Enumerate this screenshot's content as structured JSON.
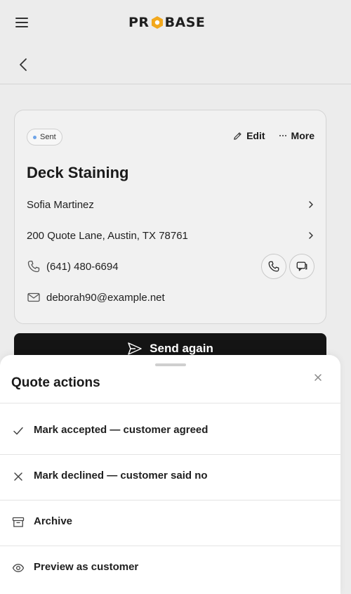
{
  "header": {
    "logo_text_left": "PR",
    "logo_text_right": "BASE",
    "menu_icon": "hamburger-menu-icon",
    "back_icon": "chevron-left-icon"
  },
  "quote": {
    "status": "Sent",
    "status_color": "#6ea4e8",
    "edit_label": "Edit",
    "more_label": "More",
    "title": "Deck Staining",
    "customer_name": "Sofia Martinez",
    "address": "200 Quote Lane, Austin, TX 78761",
    "phone": "(641) 480-6694",
    "email": "deborah90@example.net"
  },
  "send_button": {
    "label": "Send again"
  },
  "sheet": {
    "title": "Quote actions",
    "actions": [
      {
        "label": "Mark accepted — customer agreed",
        "icon": "check-icon"
      },
      {
        "label": "Mark declined — customer said no",
        "icon": "x-icon"
      },
      {
        "label": "Archive",
        "icon": "archive-box-icon"
      },
      {
        "label": "Preview as customer",
        "icon": "eye-icon"
      }
    ]
  },
  "colors": {
    "brand_accent": "#f2a81d",
    "primary_button": "#141414"
  }
}
